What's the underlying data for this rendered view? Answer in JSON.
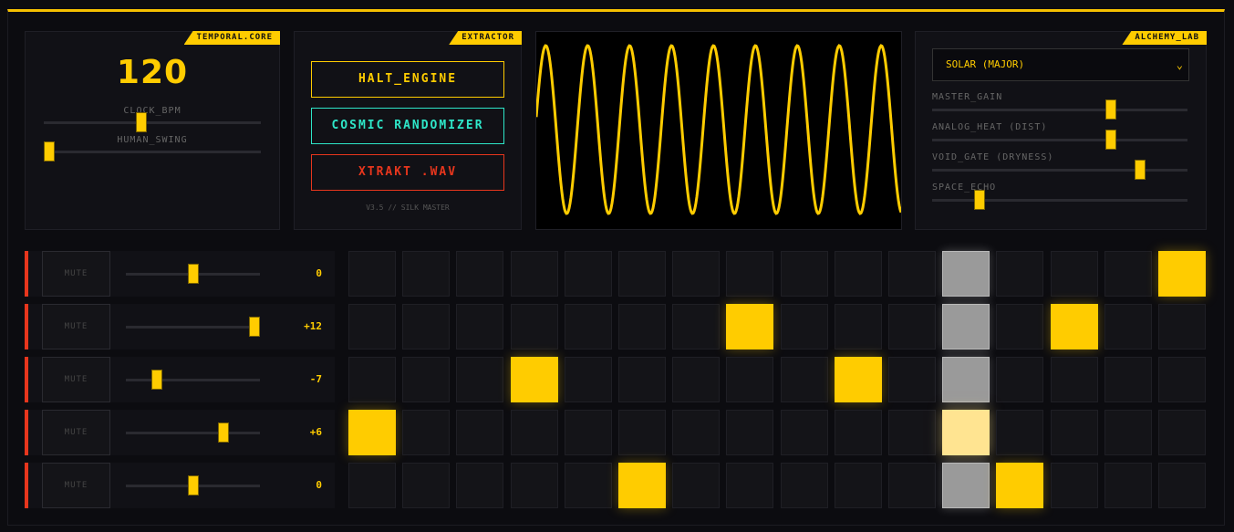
{
  "temporal": {
    "tag": "TEMPORAL.CORE",
    "bpm": "120",
    "clock_label": "CLOCK_BPM",
    "swing_label": "HUMAN_SWING",
    "clock_value": 0.45,
    "swing_value": 0.0
  },
  "extractor": {
    "tag": "EXTRACTOR",
    "halt": "HALT_ENGINE",
    "cosmic": "COSMIC RANDOMIZER",
    "xtrakt": "XTRAKT .WAV",
    "version": "V3.5 // SILK MASTER"
  },
  "colors": {
    "accent": "#ffcc00",
    "cyan": "#2ee6c8",
    "red": "#e8361d"
  },
  "alchemy": {
    "tag": "ALCHEMY_LAB",
    "scale": "SOLAR (MAJOR)",
    "sliders": [
      {
        "label": "MASTER_GAIN",
        "value": 0.71
      },
      {
        "label": "ANALOG_HEAT (DIST)",
        "value": 0.71
      },
      {
        "label": "VOID_GATE (DRYNESS)",
        "value": 0.83
      },
      {
        "label": "SPACE_ECHO",
        "value": 0.17
      }
    ]
  },
  "channels": [
    {
      "mute": "MUTE",
      "pitch": "0",
      "level": 0.5
    },
    {
      "mute": "MUTE",
      "pitch": "+12",
      "level": 1.0
    },
    {
      "mute": "MUTE",
      "pitch": "-7",
      "level": 0.21
    },
    {
      "mute": "MUTE",
      "pitch": "+6",
      "level": 0.75
    },
    {
      "mute": "MUTE",
      "pitch": "0",
      "level": 0.5
    }
  ],
  "sequencer": {
    "playhead_step": 11,
    "grid": [
      [
        0,
        0,
        0,
        0,
        0,
        0,
        0,
        0,
        0,
        0,
        0,
        0,
        0,
        0,
        0,
        1
      ],
      [
        0,
        0,
        0,
        0,
        0,
        0,
        0,
        1,
        0,
        0,
        0,
        0,
        0,
        1,
        0,
        0
      ],
      [
        0,
        0,
        0,
        1,
        0,
        0,
        0,
        0,
        0,
        1,
        0,
        0,
        0,
        0,
        0,
        0
      ],
      [
        1,
        0,
        0,
        0,
        0,
        0,
        0,
        0,
        0,
        0,
        0,
        1,
        0,
        0,
        0,
        0
      ],
      [
        0,
        0,
        0,
        0,
        0,
        1,
        0,
        0,
        0,
        0,
        0,
        0,
        1,
        0,
        0,
        0
      ]
    ]
  },
  "scope": {
    "cycles": 8.7
  }
}
